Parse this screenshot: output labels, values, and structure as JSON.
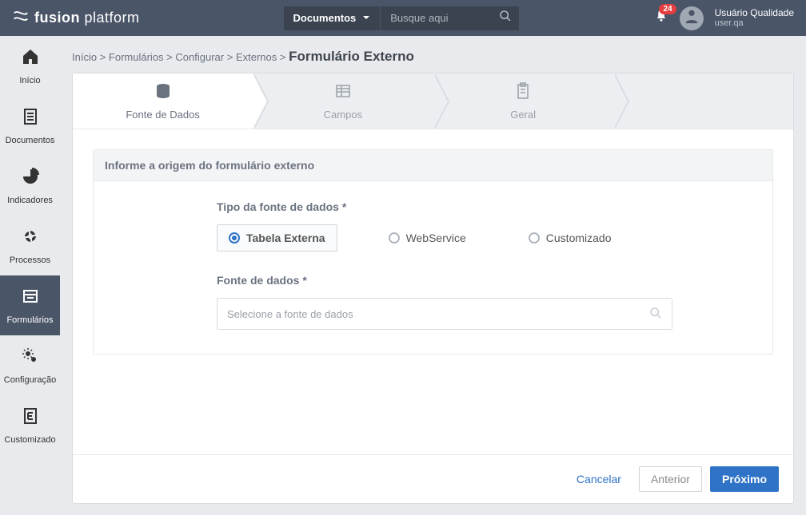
{
  "header": {
    "logo_bold": "fusion",
    "logo_light": " platform",
    "search_type": "Documentos",
    "search_placeholder": "Busque aqui",
    "notification_count": "24",
    "user_name": "Usuário Qualidade",
    "user_login": "user.qa"
  },
  "sidebar": {
    "items": [
      {
        "label": "Início"
      },
      {
        "label": "Documentos"
      },
      {
        "label": "Indicadores"
      },
      {
        "label": "Processos"
      },
      {
        "label": "Formulários"
      },
      {
        "label": "Configuração"
      },
      {
        "label": "Customizado"
      }
    ]
  },
  "breadcrumb": {
    "items": [
      "Início",
      "Formulários",
      "Configurar",
      "Externos"
    ],
    "sep": ">",
    "current": "Formulário Externo"
  },
  "steps": [
    {
      "label": "Fonte de Dados"
    },
    {
      "label": "Campos"
    },
    {
      "label": "Geral"
    }
  ],
  "panel": {
    "title": "Informe a origem do formulário externo",
    "field_type_label": "Tipo da fonte de dados *",
    "radios": [
      {
        "label": "Tabela Externa"
      },
      {
        "label": "WebService"
      },
      {
        "label": "Customizado"
      }
    ],
    "field_source_label": "Fonte de dados *",
    "source_placeholder": "Selecione a fonte de dados"
  },
  "footer": {
    "cancel": "Cancelar",
    "prev": "Anterior",
    "next": "Próximo"
  }
}
